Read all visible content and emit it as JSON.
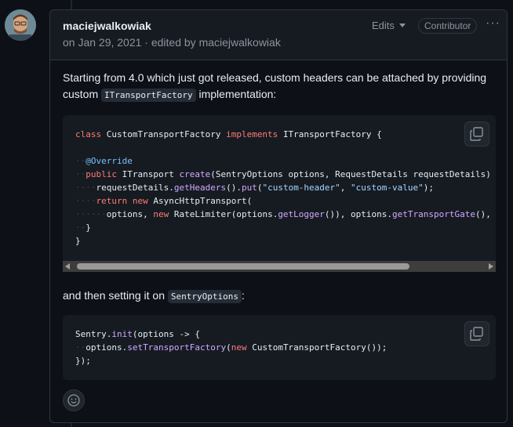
{
  "comment": {
    "author": "maciejwalkowiak",
    "meta": "on Jan 29, 2021 · edited by maciejwalkowiak",
    "edits_label": "Edits",
    "badge": "Contributor",
    "more_label": "···"
  },
  "body": {
    "p1_before": "Starting from 4.0 which just got released, custom headers can be attached by providing custom ",
    "p1_code": "ITransportFactory",
    "p1_after": " implementation:",
    "p2_before": "and then setting it on ",
    "p2_code": "SentryOptions",
    "p2_after": ":"
  },
  "code1": [
    [
      {
        "t": "class ",
        "c": "kw"
      },
      {
        "t": "CustomTransportFactory "
      },
      {
        "t": "implements ",
        "c": "kw"
      },
      {
        "t": "ITransportFactory {"
      }
    ],
    [],
    [
      {
        "t": "··",
        "c": "ws"
      },
      {
        "t": "@Override",
        "c": "ann"
      }
    ],
    [
      {
        "t": "··",
        "c": "ws"
      },
      {
        "t": "public ",
        "c": "kw"
      },
      {
        "t": "ITransport "
      },
      {
        "t": "create",
        "c": "fn"
      },
      {
        "t": "(SentryOptions options, RequestDetails requestDetails) {"
      }
    ],
    [
      {
        "t": "····",
        "c": "ws"
      },
      {
        "t": "requestDetails."
      },
      {
        "t": "getHeaders",
        "c": "fn"
      },
      {
        "t": "()."
      },
      {
        "t": "put",
        "c": "fn"
      },
      {
        "t": "("
      },
      {
        "t": "\"custom-header\"",
        "c": "str"
      },
      {
        "t": ", "
      },
      {
        "t": "\"custom-value\"",
        "c": "str"
      },
      {
        "t": ");"
      }
    ],
    [
      {
        "t": "····",
        "c": "ws"
      },
      {
        "t": "return ",
        "c": "kw"
      },
      {
        "t": "new ",
        "c": "kw"
      },
      {
        "t": "AsyncHttpTransport("
      }
    ],
    [
      {
        "t": "······",
        "c": "ws"
      },
      {
        "t": "options, "
      },
      {
        "t": "new ",
        "c": "kw"
      },
      {
        "t": "RateLimiter(options."
      },
      {
        "t": "getLogger",
        "c": "fn"
      },
      {
        "t": "()), options."
      },
      {
        "t": "getTransportGate",
        "c": "fn"
      },
      {
        "t": "(), r"
      }
    ],
    [
      {
        "t": "··",
        "c": "ws"
      },
      {
        "t": "}"
      }
    ],
    [
      {
        "t": "}"
      }
    ]
  ],
  "code2": [
    [
      {
        "t": "Sentry."
      },
      {
        "t": "init",
        "c": "fn"
      },
      {
        "t": "(options -> {"
      }
    ],
    [
      {
        "t": "··",
        "c": "ws"
      },
      {
        "t": "options."
      },
      {
        "t": "setTransportFactory",
        "c": "fn"
      },
      {
        "t": "("
      },
      {
        "t": "new ",
        "c": "kw"
      },
      {
        "t": "CustomTransportFactory());"
      }
    ],
    [
      {
        "t": "});"
      }
    ]
  ]
}
